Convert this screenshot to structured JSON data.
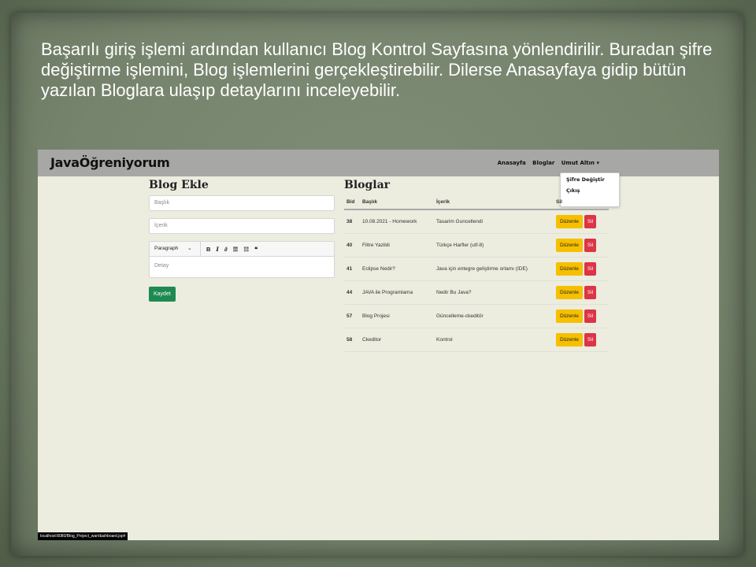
{
  "caption": "Başarılı giriş işlemi ardından kullanıcı Blog Kontrol Sayfasına yönlendirilir. Buradan şifre değiştirme işlemini, Blog işlemlerini gerçekleştirebilir. Dilerse Anasayfaya gidip bütün yazılan Bloglara ulaşıp detaylarını inceleyebilir.",
  "navbar": {
    "brand": "JavaÖğreniyorum",
    "links": [
      "Anasayfa",
      "Bloglar"
    ],
    "user_menu": "Umut Altın ▾",
    "dropdown": [
      "Şifre Değiştir",
      "Çıkış"
    ]
  },
  "add_form": {
    "title": "Blog Ekle",
    "title_placeholder": "Başlık",
    "content_placeholder": "İçerik",
    "paragraph_select": "Paragraph",
    "toolbar_icons": [
      "bold-icon",
      "italic-icon",
      "link-icon",
      "bulleted-list-icon",
      "numbered-list-icon",
      "blockquote-icon"
    ],
    "detail_placeholder": "Detay",
    "save_label": "Kaydet"
  },
  "blog_list": {
    "title": "Bloglar",
    "columns": [
      "Bid",
      "Başlık",
      "İçerik",
      "Sil"
    ],
    "rows": [
      {
        "bid": "38",
        "title": "10.08.2021 - Homework",
        "content": "Tasarim Guncellendi"
      },
      {
        "bid": "40",
        "title": "Filtre Yazildi",
        "content": "Türkçe Harfler (utf-8)"
      },
      {
        "bid": "41",
        "title": "Eclipse Nedir?",
        "content": "Java için entegre geliştirme ortamı (IDE)"
      },
      {
        "bid": "44",
        "title": "JAVA ile Programlama",
        "content": "Nedir Bu Java?"
      },
      {
        "bid": "57",
        "title": "Blog Projesi",
        "content": "Güncelleme-ckeditör"
      },
      {
        "bid": "58",
        "title": "Ckeditor",
        "content": "Kontrol"
      }
    ],
    "edit_label": "Düzenle",
    "delete_label": "Sil"
  },
  "status_url": "localhost:8080/Blog_Project_war/dashboard.jsp#"
}
